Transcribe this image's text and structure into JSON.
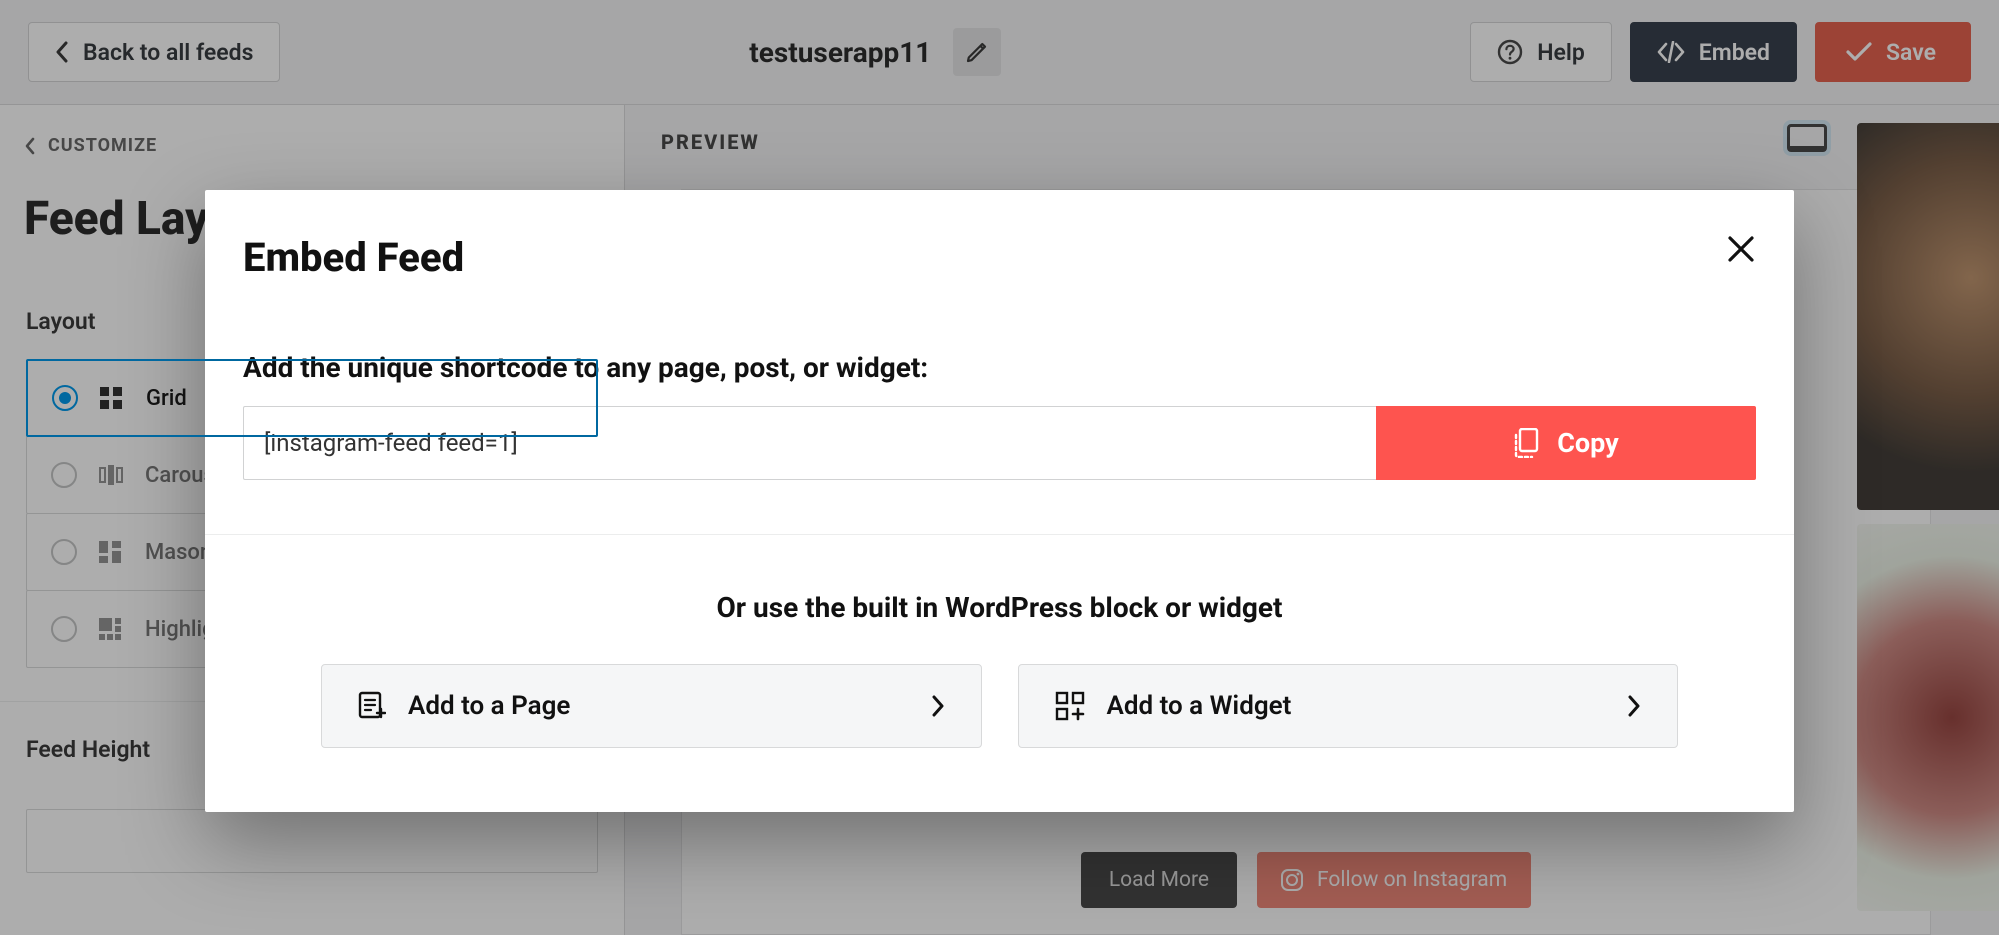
{
  "toolbar": {
    "back_label": "Back to all feeds",
    "title": "testuserapp11",
    "help_label": "Help",
    "embed_label": "Embed",
    "save_label": "Save"
  },
  "sidebar": {
    "crumb_label": "CUSTOMIZE",
    "title": "Feed Layout",
    "layout_label": "Layout",
    "layout_options": [
      {
        "label": "Grid",
        "selected": true
      },
      {
        "label": "Carousel",
        "selected": false
      },
      {
        "label": "Masonry",
        "selected": false
      },
      {
        "label": "Highlight",
        "selected": false
      }
    ],
    "feed_height_label": "Feed Height",
    "feed_height_value": ""
  },
  "preview": {
    "label": "PREVIEW",
    "load_more_label": "Load More",
    "follow_label": "Follow on Instagram"
  },
  "modal": {
    "title": "Embed Feed",
    "section1_label": "Add the unique shortcode to any page, post, or widget:",
    "shortcode_value": "[instagram-feed feed=1]",
    "copy_label": "Copy",
    "section2_label": "Or use the built in WordPress block or widget",
    "add_page_label": "Add to a Page",
    "add_widget_label": "Add to a Widget"
  }
}
